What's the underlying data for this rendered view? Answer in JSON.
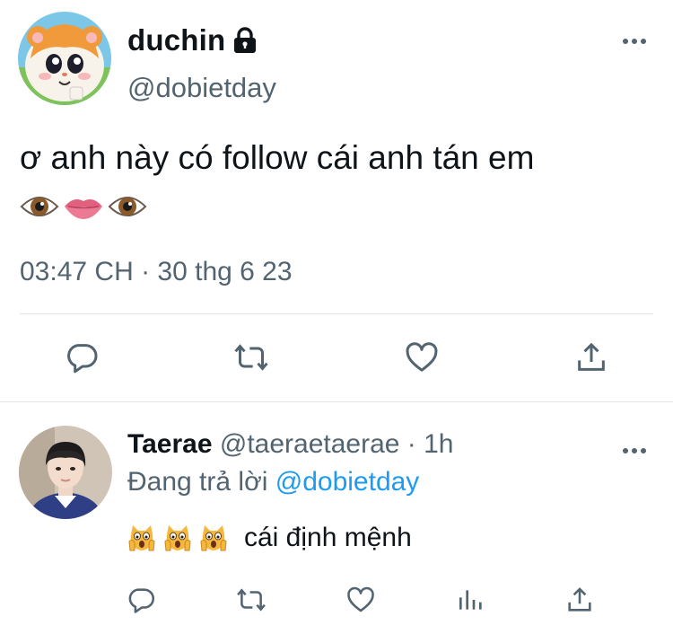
{
  "main_tweet": {
    "display_name": "duchin",
    "handle": "@dobietday",
    "text": "ơ anh này có follow cái anh tán em",
    "emojis": [
      "eye-emoji",
      "lips-emoji",
      "eye-emoji"
    ],
    "timestamp": "03:47 CH · 30 thg 6 23",
    "icons": {
      "lock": "lock-icon",
      "more": "more-options-icon",
      "reply": "reply-icon",
      "retweet": "retweet-icon",
      "like": "heart-icon",
      "share": "share-icon"
    }
  },
  "reply_tweet": {
    "display_name": "Taerae",
    "handle": "@taeraetaerae",
    "time": "· 1h",
    "replying_prefix": "Đang trả lời",
    "replying_to": "@dobietday",
    "text": "cái định mệnh",
    "emojis": [
      "scream-cat-emoji",
      "scream-cat-emoji",
      "scream-cat-emoji"
    ],
    "icons": {
      "more": "more-options-icon",
      "reply": "reply-icon",
      "retweet": "retweet-icon",
      "like": "heart-icon",
      "views": "analytics-icon",
      "share": "share-icon"
    }
  },
  "colors": {
    "text_primary": "#0f1419",
    "text_secondary": "#536471",
    "link": "#1d9bf0",
    "divider": "#e1e6ea"
  }
}
